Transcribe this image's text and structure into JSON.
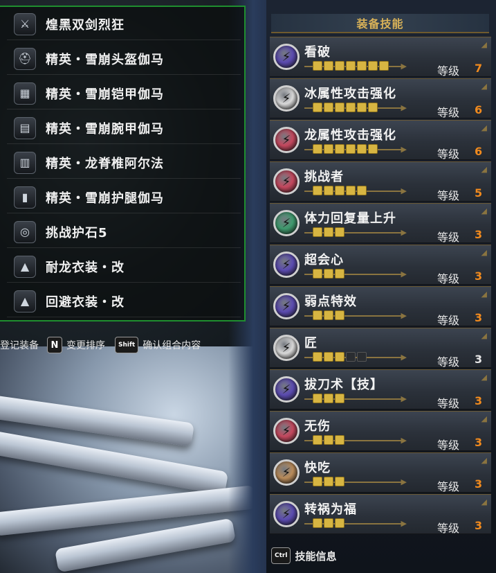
{
  "equipment": [
    {
      "label": "煌黑双剑烈狂",
      "icon": "dual-blades-icon"
    },
    {
      "label": "精英・雪崩头盔伽马",
      "icon": "helmet-icon"
    },
    {
      "label": "精英・雪崩铠甲伽马",
      "icon": "chest-armor-icon"
    },
    {
      "label": "精英・雪崩腕甲伽马",
      "icon": "arm-armor-icon"
    },
    {
      "label": "精英・龙脊椎阿尔法",
      "icon": "waist-armor-icon"
    },
    {
      "label": "精英・雪崩护腿伽马",
      "icon": "leg-armor-icon"
    },
    {
      "label": "挑战护石5",
      "icon": "charm-icon"
    },
    {
      "label": "耐龙衣装・改",
      "icon": "mantle-icon"
    },
    {
      "label": "回避衣装・改",
      "icon": "mantle-icon"
    }
  ],
  "hints": {
    "register": "登记装备",
    "sort_key": "N",
    "sort": "变更排序",
    "confirm_key": "Shift",
    "confirm": "确认组合内容",
    "info_key": "Ctrl",
    "info": "技能信息"
  },
  "skills_header": "装备技能",
  "level_word": "等级",
  "skills": [
    {
      "name": "看破",
      "level": "7",
      "max": 7,
      "color": "#5b4bb0",
      "highlight": true
    },
    {
      "name": "冰属性攻击强化",
      "level": "6",
      "max": 6,
      "color": "#d9d9d9",
      "highlight": true
    },
    {
      "name": "龙属性攻击强化",
      "level": "6",
      "max": 6,
      "color": "#c4485e",
      "highlight": true
    },
    {
      "name": "挑战者",
      "level": "5",
      "max": 5,
      "color": "#c4485e",
      "highlight": true
    },
    {
      "name": "体力回复量上升",
      "level": "3",
      "max": 3,
      "color": "#3f9a6e",
      "highlight": true
    },
    {
      "name": "超会心",
      "level": "3",
      "max": 3,
      "color": "#5b4bb0",
      "highlight": true
    },
    {
      "name": "弱点特效",
      "level": "3",
      "max": 3,
      "color": "#5b4bb0",
      "highlight": true
    },
    {
      "name": "匠",
      "level": "3",
      "max": 5,
      "color": "#d9d9d9",
      "highlight": false
    },
    {
      "name": "拔刀术【技】",
      "level": "3",
      "max": 3,
      "color": "#5b4bb0",
      "highlight": true
    },
    {
      "name": "无伤",
      "level": "3",
      "max": 3,
      "color": "#c4485e",
      "highlight": true
    },
    {
      "name": "快吃",
      "level": "3",
      "max": 3,
      "color": "#b98b5a",
      "highlight": true
    },
    {
      "name": "转祸为福",
      "level": "3",
      "max": 3,
      "color": "#5b4bb0",
      "highlight": true
    }
  ],
  "colors": {
    "level_max": "#f08a1e",
    "level_normal": "#e6e6e6",
    "header_text": "#d8b158",
    "panel_border": "#1f8f2f"
  }
}
